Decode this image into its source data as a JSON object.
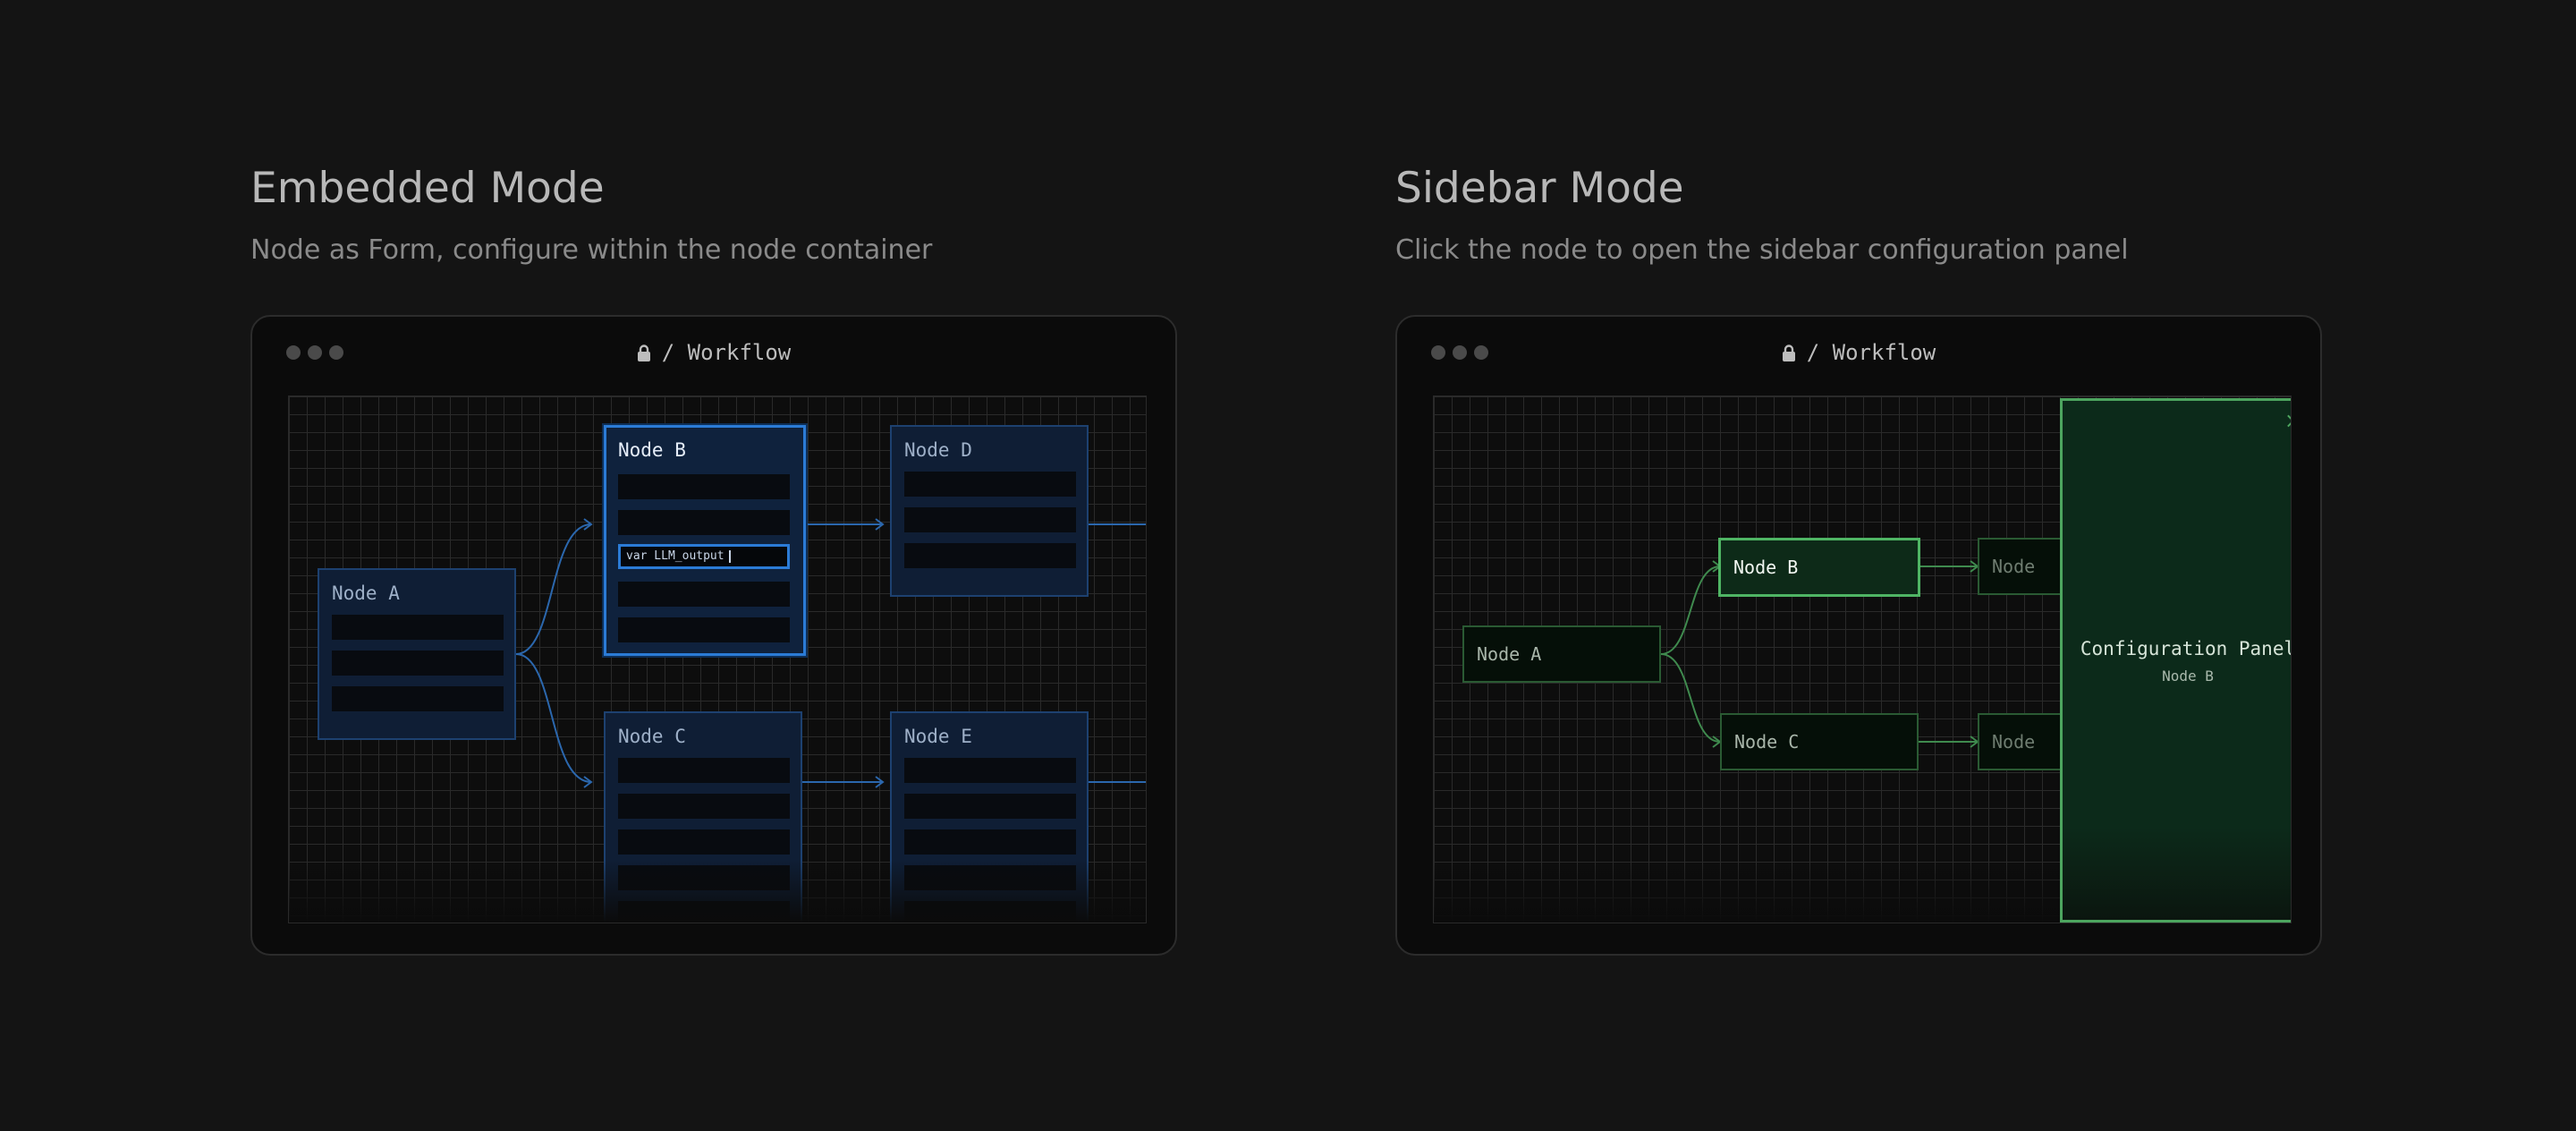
{
  "embedded": {
    "title": "Embedded Mode",
    "subtitle": "Node as Form, configure within the node container",
    "window_title": "/ Workflow",
    "nodes": {
      "a": "Node A",
      "b": "Node B",
      "c": "Node C",
      "d": "Node D",
      "e": "Node E"
    },
    "active_field_value": "var LLM_output",
    "accent_color": "#2b7bd6"
  },
  "sidebar": {
    "title": "Sidebar Mode",
    "subtitle": "Click the node to open the sidebar configuration panel",
    "window_title": "/ Workflow",
    "nodes": {
      "a": "Node A",
      "b": "Node B",
      "c": "Node C",
      "d_partial": "Node",
      "e_partial": "Node"
    },
    "panel_title": "Configuration Panel",
    "panel_subtitle": "Node B",
    "accent_color": "#4fb564"
  },
  "icons": [
    "lock-icon",
    "close-icon"
  ]
}
